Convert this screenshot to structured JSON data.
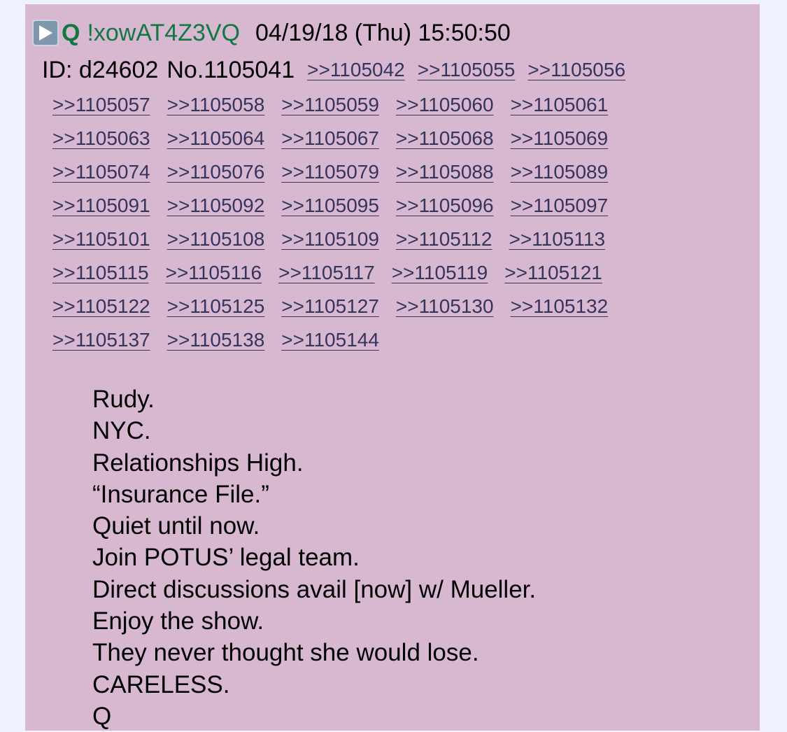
{
  "post": {
    "name": "Q",
    "tripcode": "!xowAT4Z3VQ",
    "datetime": "04/19/18 (Thu) 15:50:50",
    "id_text": "ID: d24602",
    "post_number": "No.1105041",
    "header_replies": [
      ">>1105042",
      ">>1105055",
      ">>1105056"
    ],
    "reply_rows": [
      [
        ">>1105057",
        ">>1105058",
        ">>1105059",
        ">>1105060",
        ">>1105061"
      ],
      [
        ">>1105063",
        ">>1105064",
        ">>1105067",
        ">>1105068",
        ">>1105069"
      ],
      [
        ">>1105074",
        ">>1105076",
        ">>1105079",
        ">>1105088",
        ">>1105089"
      ],
      [
        ">>1105091",
        ">>1105092",
        ">>1105095",
        ">>1105096",
        ">>1105097"
      ],
      [
        ">>1105101",
        ">>1105108",
        ">>1105109",
        ">>1105112",
        ">>1105113"
      ],
      [
        ">>1105115",
        ">>1105116",
        ">>1105117",
        ">>1105119",
        ">>1105121"
      ],
      [
        ">>1105122",
        ">>1105125",
        ">>1105127",
        ">>1105130",
        ">>1105132"
      ],
      [
        ">>1105137",
        ">>1105138",
        ">>1105144"
      ]
    ],
    "message_lines": [
      "Rudy.",
      "NYC.",
      "Relationships High.",
      "“Insurance File.”",
      "Quiet until now.",
      "Join POTUS’ legal team.",
      "Direct discussions avail [now] w/ Mueller.",
      "Enjoy the show.",
      "They never thought she would lose.",
      "CARELESS.",
      "Q"
    ],
    "icons": {
      "expand": "play-triangle-icon"
    },
    "colors": {
      "page_background": "#eef2ff",
      "post_background": "#d8b8d0",
      "name_color": "#117743",
      "link_color": "#34345c"
    }
  }
}
